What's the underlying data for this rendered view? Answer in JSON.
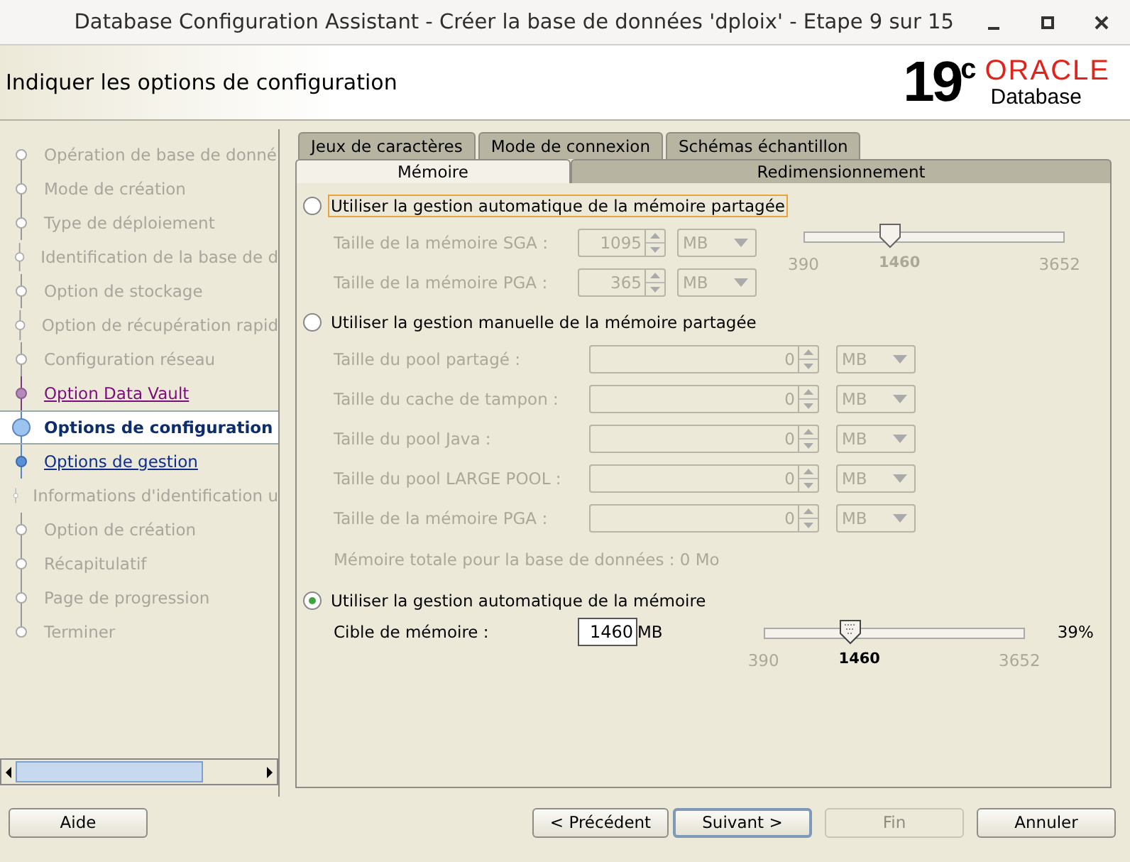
{
  "window": {
    "title": "Database Configuration Assistant - Créer la base de données 'dploix' - Etape 9 sur 15"
  },
  "header": {
    "title": "Indiquer les options de configuration",
    "logo": {
      "version": "19",
      "version_mark": "c",
      "brand": "ORACLE",
      "product": "Database"
    }
  },
  "steps": [
    {
      "label": "Opération de base de donné",
      "enabled": false,
      "visited": false,
      "selected": false
    },
    {
      "label": "Mode de création",
      "enabled": false,
      "visited": false,
      "selected": false
    },
    {
      "label": "Type de déploiement",
      "enabled": false,
      "visited": false,
      "selected": false
    },
    {
      "label": "Identification de la base de d",
      "enabled": false,
      "visited": false,
      "selected": false
    },
    {
      "label": "Option de stockage",
      "enabled": false,
      "visited": false,
      "selected": false
    },
    {
      "label": "Option de récupération rapid",
      "enabled": false,
      "visited": false,
      "selected": false
    },
    {
      "label": "Configuration réseau",
      "enabled": false,
      "visited": false,
      "selected": false
    },
    {
      "label": "Option Data Vault",
      "enabled": true,
      "visited": true,
      "selected": false
    },
    {
      "label": "Options de configuration",
      "enabled": true,
      "visited": false,
      "selected": true
    },
    {
      "label": "Options de gestion",
      "enabled": true,
      "visited": false,
      "selected": false
    },
    {
      "label": "Informations d'identification u",
      "enabled": false,
      "visited": false,
      "selected": false
    },
    {
      "label": "Option de création",
      "enabled": false,
      "visited": false,
      "selected": false
    },
    {
      "label": "Récapitulatif",
      "enabled": false,
      "visited": false,
      "selected": false
    },
    {
      "label": "Page de progression",
      "enabled": false,
      "visited": false,
      "selected": false
    },
    {
      "label": "Terminer",
      "enabled": false,
      "visited": false,
      "selected": false
    }
  ],
  "tabs": {
    "rows": [
      [
        {
          "label": "Jeux de caractères",
          "selected": false
        },
        {
          "label": "Mode de connexion",
          "selected": false
        },
        {
          "label": "Schémas échantillon",
          "selected": false
        }
      ],
      [
        {
          "label": "Mémoire",
          "selected": true
        },
        {
          "label": "Redimensionnement",
          "selected": false
        }
      ]
    ]
  },
  "memory_options": [
    {
      "kind": "automatic_shared",
      "label": "Utiliser la gestion automatique de la mémoire partagée",
      "selected": false,
      "focused": true,
      "fields": [
        {
          "label": "Taille de la mémoire SGA :",
          "value": "1095",
          "unit": "MB"
        },
        {
          "label": "Taille de la mémoire PGA :",
          "value": "365",
          "unit": "MB"
        }
      ],
      "slider": {
        "min": "390",
        "value": "1460",
        "max": "3652",
        "level": 0.328
      }
    },
    {
      "kind": "manual_shared",
      "label": "Utiliser la gestion manuelle de la mémoire partagée",
      "selected": false,
      "focused": false,
      "fields": [
        {
          "label": "Taille du pool partagé :",
          "value": "0",
          "unit": "MB"
        },
        {
          "label": "Taille du cache de tampon :",
          "value": "0",
          "unit": "MB"
        },
        {
          "label": "Taille du pool Java :",
          "value": "0",
          "unit": "MB"
        },
        {
          "label": "Taille du pool LARGE POOL :",
          "value": "0",
          "unit": "MB"
        },
        {
          "label": "Taille de la mémoire PGA :",
          "value": "0",
          "unit": "MB"
        }
      ],
      "total": "Mémoire totale pour la base de données : 0 Mo"
    },
    {
      "kind": "automatic",
      "label": "Utiliser la gestion automatique de la mémoire",
      "selected": true,
      "focused": false,
      "target": {
        "label": "Cible de mémoire :",
        "value": "1460",
        "unit": "MB"
      },
      "slider": {
        "min": "390",
        "value": "1460",
        "max": "3652",
        "level": 0.328,
        "percent": "39%"
      }
    }
  ],
  "buttons": [
    {
      "label": "Aide",
      "disabled": false,
      "default": false
    },
    {
      "label": "< Précédent",
      "disabled": false,
      "default": false
    },
    {
      "label": "Suivant >",
      "disabled": false,
      "default": true
    },
    {
      "label": "Fin",
      "disabled": true,
      "default": false
    },
    {
      "label": "Annuler",
      "disabled": false,
      "default": false
    }
  ]
}
